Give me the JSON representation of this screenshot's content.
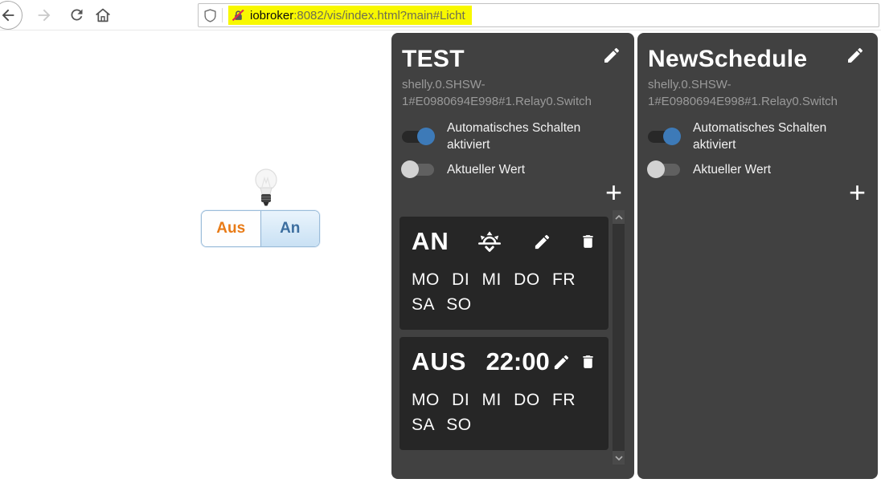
{
  "browser": {
    "url_host": "iobroker",
    "url_rest": ":8082/vis/index.html?main#Licht",
    "highlight_color": "#f8f800"
  },
  "light_widget": {
    "off_label": "Aus",
    "on_label": "An",
    "off_color": "#e87b17",
    "on_color": "#3c6e9f"
  },
  "panels": [
    {
      "title": "TEST",
      "datapoint": "shelly.0.SHSW-1#E0980694E998#1.Relay0.Switch",
      "toggles": [
        {
          "label": "Automatisches Schalten aktiviert",
          "on": true
        },
        {
          "label": "Aktueller Wert",
          "on": false
        }
      ],
      "add_label": "+",
      "entries": [
        {
          "state": "AN",
          "time": "",
          "days": "MO DI MI DO FR SA SO",
          "has_astro_icon": true
        },
        {
          "state": "AUS",
          "time": "22:00",
          "days": "MO DI MI DO FR SA SO",
          "has_astro_icon": false
        }
      ]
    },
    {
      "title": "NewSchedule",
      "datapoint": "shelly.0.SHSW-1#E0980694E998#1.Relay0.Switch",
      "toggles": [
        {
          "label": "Automatisches Schalten aktiviert",
          "on": true
        },
        {
          "label": "Aktueller Wert",
          "on": false
        }
      ],
      "add_label": "+",
      "entries": []
    }
  ],
  "colors": {
    "panel_bg": "#414141",
    "card_bg": "#262626",
    "accent_blue": "#3d7ab8"
  }
}
